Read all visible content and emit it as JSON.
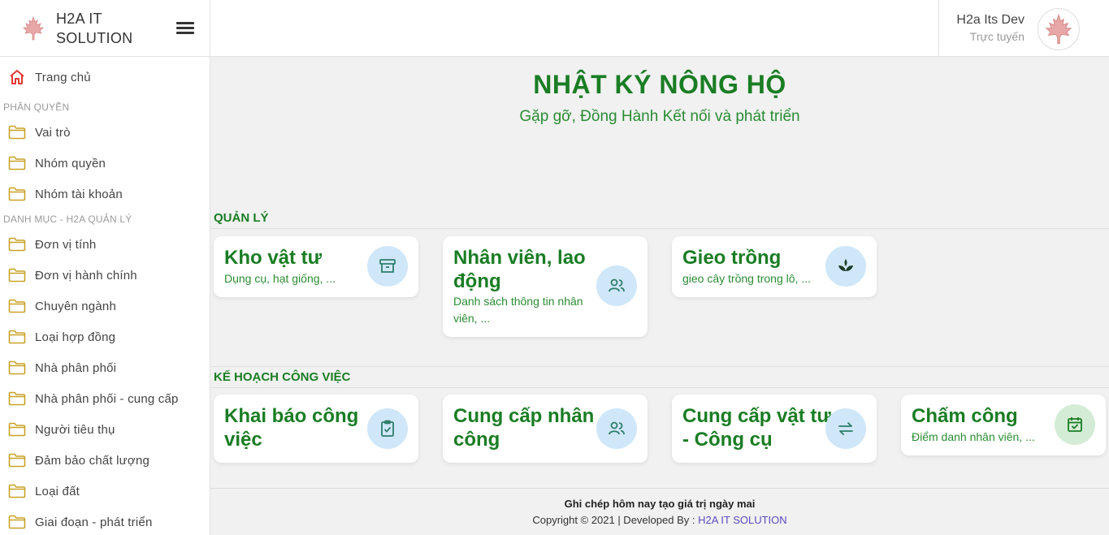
{
  "brand": {
    "name_line1": "H2A IT",
    "name_line2": "SOLUTION"
  },
  "user": {
    "name": "H2a Its Dev",
    "status": "Trực tuyến"
  },
  "sidebar": {
    "home": {
      "label": "Trang chủ",
      "icon": "home-icon"
    },
    "sections": [
      {
        "title": "PHÂN QUYỀN",
        "items": [
          "Vai trò",
          "Nhóm quyền",
          "Nhóm tài khoản"
        ]
      },
      {
        "title": "DANH MỤC - H2A QUẢN LÝ",
        "items": [
          "Đơn vị tính",
          "Đơn vị hành chính",
          "Chuyên ngành",
          "Loại hợp đồng",
          "Nhà phân phối",
          "Nhà phân phối - cung cấp",
          "Người tiêu thụ",
          "Đảm bảo chất lượng",
          "Loại đất",
          "Giai đoạn - phát triển"
        ]
      }
    ]
  },
  "hero": {
    "title": "NHẬT KÝ NÔNG HỘ",
    "subtitle": "Gặp gỡ, Đồng Hành Kết nối và phát triển"
  },
  "management": {
    "title": "QUẢN LÝ",
    "cards": [
      {
        "title_l1": "Kho vật tư",
        "title_l2": "",
        "desc_l1": "Dụng cụ, hạt giống, ...",
        "desc_l2": "",
        "icon": "archive-icon"
      },
      {
        "title_l1": "Nhân viên, lao",
        "title_l2": "động",
        "desc_l1": "Danh sách thông tin nhân",
        "desc_l2": "viên, ...",
        "icon": "users-icon"
      },
      {
        "title_l1": "Gieo trồng",
        "title_l2": "",
        "desc_l1": "gieo cây trồng trong lô, ...",
        "desc_l2": "",
        "icon": "sprout-icon"
      }
    ]
  },
  "work_plan": {
    "title": "KẾ HOẠCH CÔNG VIỆC",
    "cards": [
      {
        "title_l1": "Khai báo công",
        "title_l2": "việc",
        "desc_l1": "",
        "icon": "clipboard-check-icon"
      },
      {
        "title_l1": "Cung cấp nhân",
        "title_l2": "công",
        "desc_l1": "",
        "icon": "users-icon"
      },
      {
        "title_l1": "Cung cấp vật tư",
        "title_l2": "- Công cụ",
        "desc_l1": "",
        "icon": "exchange-icon"
      },
      {
        "title_l1": "Chấm công",
        "title_l2": "",
        "desc_l1": "Điểm danh nhân viên, ...",
        "icon": "calendar-check-icon"
      }
    ]
  },
  "footer": {
    "slogan": "Ghi chép hôm nay tạo giá trị ngày mai",
    "copyright": "Copyright © 2021 | Developed By : ",
    "developer": "H2A IT SOLUTION"
  },
  "colors": {
    "primary_green": "#1a7d24",
    "icon_bg_blue": "#cfe7f8",
    "icon_bg_green": "#d4ecd6",
    "folder": "#c9a227",
    "home": "#e53935"
  }
}
